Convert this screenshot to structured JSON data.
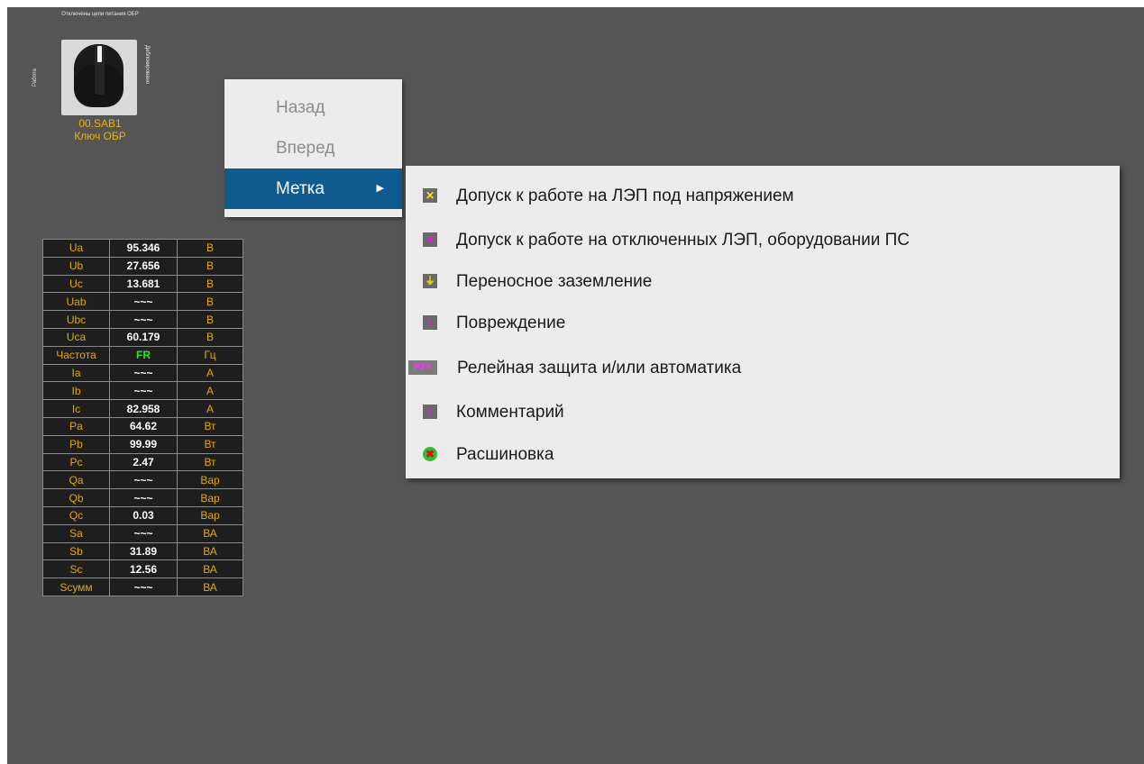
{
  "switch": {
    "caption_top": "Отключены цепи питания ОБР",
    "label_left": "Работа",
    "label_right": "Деблокировано",
    "code": "00.SAB1",
    "name": "Ключ ОБР"
  },
  "table": {
    "rows": [
      {
        "name": "Ua",
        "value": "95.346",
        "unit": "В"
      },
      {
        "name": "Ub",
        "value": "27.656",
        "unit": "В"
      },
      {
        "name": "Uc",
        "value": "13.681",
        "unit": "В"
      },
      {
        "name": "Uab",
        "value": "~~~",
        "unit": "В"
      },
      {
        "name": "Ubc",
        "value": "~~~",
        "unit": "В"
      },
      {
        "name": "Uca",
        "value": "60.179",
        "unit": "В"
      },
      {
        "name": "Частота",
        "value": "FR",
        "unit": "Гц"
      },
      {
        "name": "Ia",
        "value": "~~~",
        "unit": "А"
      },
      {
        "name": "Ib",
        "value": "~~~",
        "unit": "А"
      },
      {
        "name": "Ic",
        "value": "82.958",
        "unit": "А"
      },
      {
        "name": "Pa",
        "value": "64.62",
        "unit": "Вт"
      },
      {
        "name": "Pb",
        "value": "99.99",
        "unit": "Вт"
      },
      {
        "name": "Pc",
        "value": "2.47",
        "unit": "Вт"
      },
      {
        "name": "Qa",
        "value": "~~~",
        "unit": "Вар"
      },
      {
        "name": "Qb",
        "value": "~~~",
        "unit": "Вар"
      },
      {
        "name": "Qc",
        "value": "0.03",
        "unit": "Вар"
      },
      {
        "name": "Sa",
        "value": "~~~",
        "unit": "ВА"
      },
      {
        "name": "Sb",
        "value": "31.89",
        "unit": "ВА"
      },
      {
        "name": "Sc",
        "value": "12.56",
        "unit": "ВА"
      },
      {
        "name": "Sсумм",
        "value": "~~~",
        "unit": "ВА"
      }
    ]
  },
  "context_menu": {
    "items": [
      {
        "label": "Назад",
        "enabled": false
      },
      {
        "label": "Вперед",
        "enabled": false
      },
      {
        "label": "Метка",
        "enabled": true,
        "submenu_arrow": "▶"
      }
    ]
  },
  "submenu": {
    "items": [
      {
        "label": "Допуск к работе на ЛЭП под напряжением",
        "icon": "yellow-cross-icon",
        "glyph": "✕"
      },
      {
        "label": "Допуск к работе на отключенных ЛЭП, оборудовании ПС",
        "icon": "magenta-cross-icon",
        "glyph": "✕"
      },
      {
        "label": "Переносное заземление",
        "icon": "ground-icon",
        "glyph": "⏚"
      },
      {
        "label": "Повреждение",
        "icon": "lightning-icon",
        "glyph": "ϟ"
      },
      {
        "label": "Релейная защита и/или автоматика",
        "icon": "rza-icon",
        "glyph": "РЗА"
      },
      {
        "label": "Комментарий",
        "icon": "comment-icon",
        "glyph": "I"
      },
      {
        "label": "Расшиновка",
        "icon": "red-x-circle-icon",
        "glyph": "✖"
      }
    ]
  },
  "colors": {
    "background": "#555555",
    "label": "#e6a800",
    "value": "#ffffff",
    "freq_value": "#30e030",
    "menu_highlight": "#0f5a8e"
  }
}
